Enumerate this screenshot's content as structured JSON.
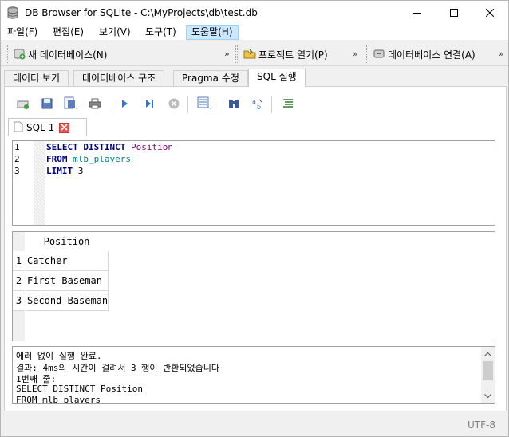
{
  "window": {
    "title": "DB Browser for SQLite - C:\\MyProjects\\db\\test.db",
    "app_icon": "database-icon",
    "controls": [
      "minimize-icon",
      "maximize-icon",
      "close-icon"
    ]
  },
  "menu": {
    "items": [
      "파일(F)",
      "편집(E)",
      "보기(V)",
      "도구(T)",
      "도움말(H)"
    ]
  },
  "toolbar": {
    "new_db": "새 데이터베이스(N)",
    "open_project": "프로젝트 열기(P)",
    "connect_db": "데이터베이스 연결(A)",
    "overflow": "»"
  },
  "tabs": [
    "데이터 보기",
    "데이터베이스 구조",
    "Pragma 수정",
    "SQL 실행"
  ],
  "active_tab": "SQL 실행",
  "sql_editor": {
    "tab_label": "SQL 1",
    "line_numbers": [
      "1",
      "2",
      "3"
    ],
    "lines": [
      {
        "kw": "SELECT DISTINCT",
        "rest": "Position"
      },
      {
        "kw": "FROM",
        "rest": "mlb_players"
      },
      {
        "kw": "LIMIT",
        "rest": "3"
      }
    ]
  },
  "results": {
    "columns": [
      "Position"
    ],
    "row_numbers": [
      "1",
      "2",
      "3"
    ],
    "rows": [
      "Catcher",
      "First Baseman",
      "Second Baseman"
    ]
  },
  "messages": {
    "lines": [
      "에러 없이 실행 완료.",
      "결과: 4ms의 시간이 걸려서 3 행이 반환되었습니다",
      "1번째 줄:",
      "SELECT DISTINCT Position",
      "FROM mlb_players"
    ]
  },
  "status": {
    "encoding": "UTF-8"
  }
}
